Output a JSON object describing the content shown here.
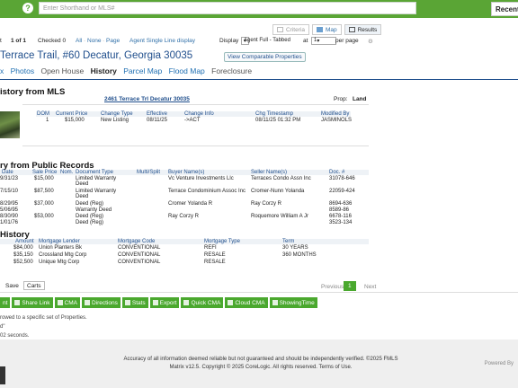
{
  "top": {
    "help_glyph": "?",
    "search_placeholder": "Enter Shorthand or MLS#",
    "recent_label": "Recent"
  },
  "view_tabs": {
    "criteria": "Criteria",
    "map": "Map",
    "results": "Results"
  },
  "toolbar_row": {
    "page_prefix": "t",
    "page_of": "1 of 1",
    "checked": "Checked 0",
    "all": "All",
    "none": "None",
    "page": "Page",
    "agent_single": "Agent Single Line display",
    "display_label": "Display",
    "display_value": "Agent Full - Tabbed",
    "at_label": "at",
    "per_page_value": "1",
    "per_page_label": "per page"
  },
  "listing": {
    "title": "Terrace Trail, #60 Decatur, Georgia 30035",
    "view_comparable": "View Comparable Properties"
  },
  "subtabs": [
    "x",
    "Photos",
    "Open House",
    "History",
    "Parcel Map",
    "Flood Map",
    "Foreclosure"
  ],
  "mls_history": {
    "title": "istory from MLS",
    "address_link": "2461 Terrace Trl Decatur 30035",
    "prop_label": "Prop:",
    "prop_value": "Land",
    "headers": [
      "DOM",
      "Current Price",
      "Change Type",
      "Effective",
      "Change Info",
      "Chg Timestamp",
      "Modified By"
    ],
    "row": [
      "1",
      "$15,000",
      "New Listing",
      "08/11/25",
      "->ACT",
      "08/11/25 01:32 PM",
      "JASMINOLS"
    ]
  },
  "public_records": {
    "title": "ry from Public Records",
    "headers": [
      "Date",
      "Sale Price",
      "Nom.",
      "Document Type",
      "Multi/Split",
      "Buyer Name(s)",
      "Seller Name(s)",
      "Doc. #"
    ],
    "rows": [
      [
        "9/31/23",
        "$15,000",
        "",
        "Limited Warranty Deed",
        "",
        "Vc Venture Investments Llc",
        "Terraces Condo Assn Inc",
        "31078-646"
      ],
      [
        "7/15/10",
        "$87,500",
        "",
        "Limited Warranty Deed",
        "",
        "Terrace Condominium Assoc Inc",
        "Cromer-Nunn Yolanda",
        "22059-424"
      ],
      [
        "8/29/95",
        "$37,000",
        "",
        "Deed (Reg)",
        "",
        "Cromer Yolanda R",
        "Ray Corzy R",
        "8694-636"
      ],
      [
        "5/06/95",
        "",
        "",
        "Warranty Deed",
        "",
        "",
        "",
        "8589-86"
      ],
      [
        "8/30/90",
        "$53,000",
        "",
        "Deed (Reg)",
        "",
        "Ray Corzy R",
        "Roquemore William A Jr",
        "6678-116"
      ],
      [
        "1/01/76",
        "",
        "",
        "Deed (Reg)",
        "",
        "",
        "",
        "3523-134"
      ]
    ]
  },
  "mortgage": {
    "title": "History",
    "headers": [
      "Amount",
      "Mortgage Lender",
      "Mortgage Code",
      "Mortgage Type",
      "Term"
    ],
    "rows": [
      [
        "$84,000",
        "Union Planters Bk",
        "CONVENTIONAL",
        "REFI",
        "30 YEARS"
      ],
      [
        "$35,150",
        "Crossland Mtg Corp",
        "CONVENTIONAL",
        "RESALE",
        "360 MONTHS"
      ],
      [
        "$52,500",
        "Unique Mtg Corp",
        "CONVENTIONAL",
        "RESALE",
        ""
      ]
    ]
  },
  "bottom": {
    "save": "Save",
    "carts": "Carts",
    "previous": "Previous",
    "page_num": "1",
    "next": "Next",
    "tools": [
      "nt",
      "Share Link",
      "CMA",
      "Directions",
      "Stats",
      "Export",
      "Quick CMA",
      "Cloud CMA",
      "ShowingTime"
    ],
    "notes": [
      "rowed to a specific set of Properties.",
      "d\"",
      "02 seconds."
    ]
  },
  "footer": {
    "line1": "Accuracy of all information deemed reliable but not guaranteed and should be independently verified. ©2025 FMLS",
    "line2": "Matrix v12.5. Copyright © 2025 CoreLogic. All rights reserved. Terms of Use.",
    "powered_by": "Powered By"
  },
  "colors": {
    "brand_green": "#5aa535",
    "link_blue": "#1f4e8c"
  }
}
